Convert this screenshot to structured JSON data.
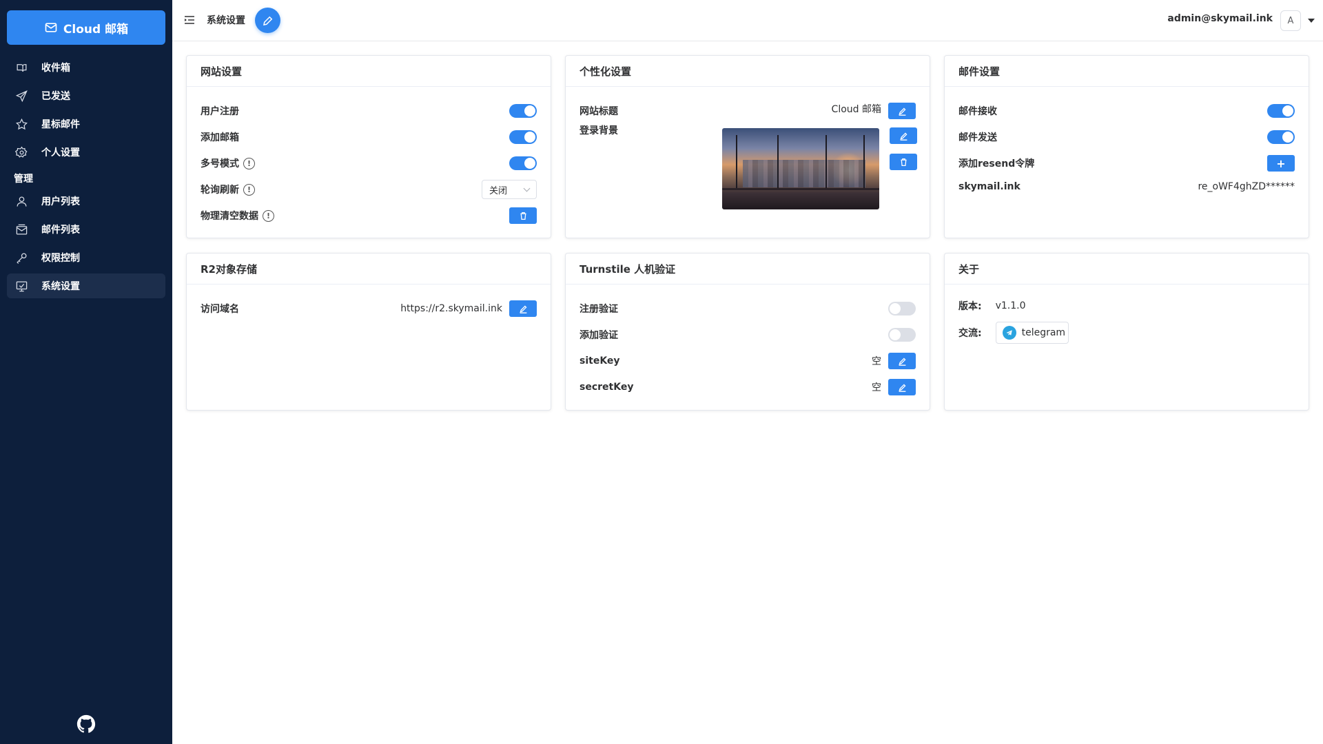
{
  "sidebar": {
    "brand": "Cloud 邮箱",
    "items": [
      {
        "label": "收件箱",
        "icon": "inbox-icon"
      },
      {
        "label": "已发送",
        "icon": "send-icon"
      },
      {
        "label": "星标邮件",
        "icon": "star-icon"
      },
      {
        "label": "个人设置",
        "icon": "gear-icon"
      }
    ],
    "group_label": "管理",
    "admin_items": [
      {
        "label": "用户列表",
        "icon": "user-icon"
      },
      {
        "label": "邮件列表",
        "icon": "mail-list-icon"
      },
      {
        "label": "权限控制",
        "icon": "key-icon"
      },
      {
        "label": "系统设置",
        "icon": "monitor-settings-icon",
        "active": true
      }
    ]
  },
  "header": {
    "title": "系统设置",
    "user_email": "admin@skymail.ink",
    "avatar_letter": "A"
  },
  "cards": {
    "website": {
      "title": "网站设置",
      "rows": [
        {
          "label": "用户注册",
          "enabled": true
        },
        {
          "label": "添加邮箱",
          "enabled": true
        },
        {
          "label": "多号模式",
          "enabled": true
        },
        {
          "label": "轮询刷新",
          "select_value": "关闭"
        },
        {
          "label": "物理清空数据"
        }
      ]
    },
    "personalize": {
      "title": "个性化设置",
      "site_title_label": "网站标题",
      "site_title_value": "Cloud 邮箱",
      "login_bg_label": "登录背景"
    },
    "mail": {
      "title": "邮件设置",
      "rows": [
        {
          "label": "邮件接收",
          "enabled": true
        },
        {
          "label": "邮件发送",
          "enabled": true
        },
        {
          "label": "添加resend令牌"
        },
        {
          "label": "skymail.ink",
          "value": "re_oWF4ghZD******"
        }
      ]
    },
    "r2": {
      "title": "R2对象存储",
      "domain_label": "访问域名",
      "domain_value": "https://r2.skymail.ink"
    },
    "turnstile": {
      "title": "Turnstile 人机验证",
      "rows": [
        {
          "label": "注册验证",
          "enabled": false
        },
        {
          "label": "添加验证",
          "enabled": false
        },
        {
          "label": "siteKey",
          "value": "空"
        },
        {
          "label": "secretKey",
          "value": "空"
        }
      ]
    },
    "about": {
      "title": "关于",
      "version_label": "版本:",
      "version_value": "v1.1.0",
      "community_label": "交流:",
      "community_button": "telegram"
    }
  },
  "colors": {
    "sidebar_bg": "#0d1f3c",
    "accent": "#2f86f0",
    "switch_off": "#dcdfe6"
  }
}
